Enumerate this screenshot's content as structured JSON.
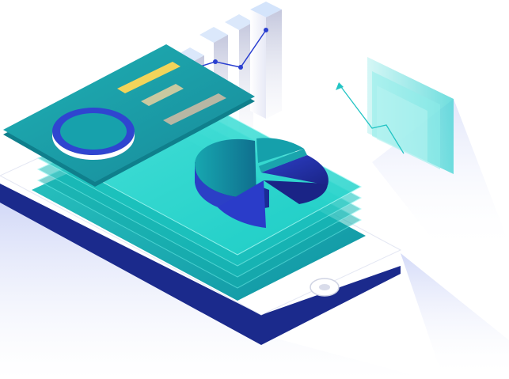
{
  "illustration": {
    "subject": "isometric-phone-analytics",
    "icons": [
      "smartphone",
      "ring-chart",
      "pie-chart",
      "bar-chart",
      "line-chart",
      "floating-panel"
    ],
    "colors": {
      "teal_light": "#3ee0d6",
      "teal": "#1fb4b5",
      "teal_dark": "#0f8c98",
      "navy": "#1b2a8c",
      "blue": "#3149d6",
      "yellow": "#f2d45a",
      "khaki": "#c9c9a0",
      "gray_bar": "#b8b7a4",
      "lavender": "#d8dcf4"
    }
  }
}
